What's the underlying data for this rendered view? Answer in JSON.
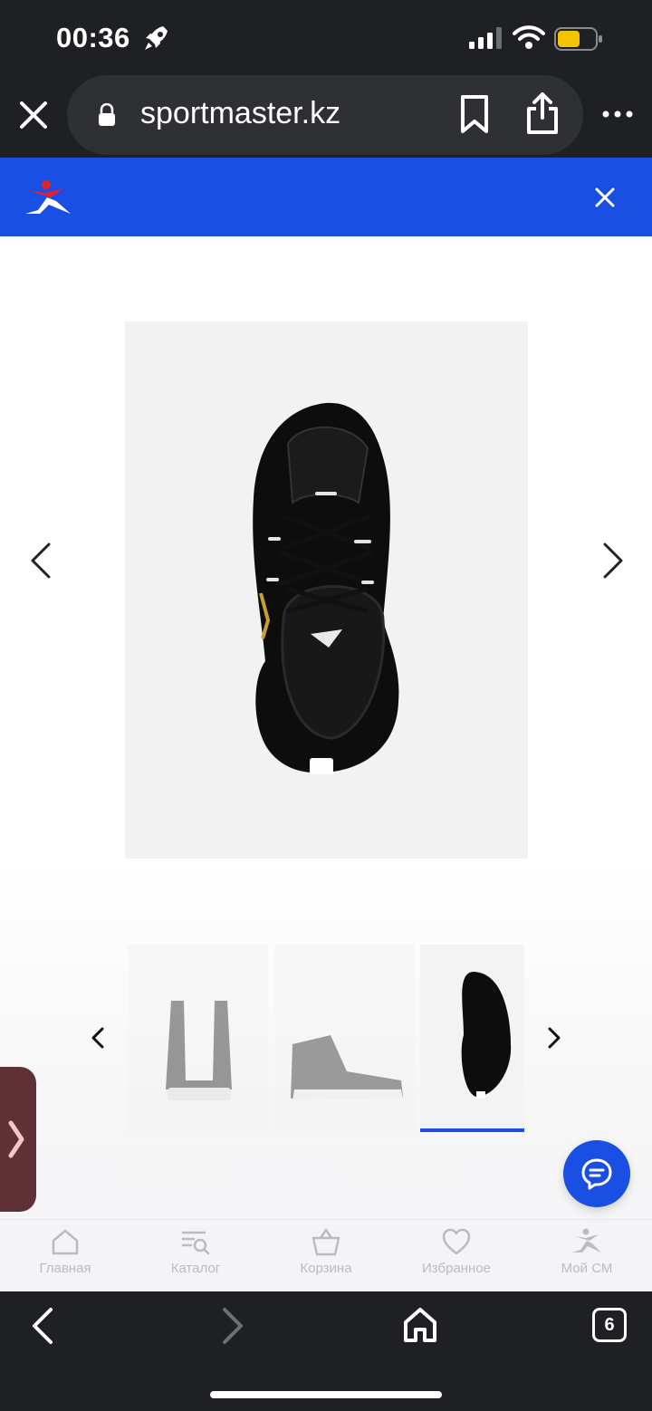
{
  "status_bar": {
    "time": "00:36",
    "icons": [
      "rocket-icon",
      "signal-icon",
      "wifi-icon",
      "battery-icon"
    ],
    "battery_color": "#f5c400"
  },
  "browser": {
    "url": "sportmaster.kz",
    "tab_count": "6",
    "icons": [
      "close-icon",
      "lock-icon",
      "bookmark-icon",
      "share-icon",
      "more-icon",
      "back-icon",
      "forward-icon",
      "home-icon"
    ]
  },
  "banner": {
    "brand_color": "#1a4fe3",
    "logo": "sportmaster-logo",
    "close_icon": "close-icon"
  },
  "product_gallery": {
    "selected_index": 3,
    "thumbnails": [
      {
        "view": "back"
      },
      {
        "view": "side"
      },
      {
        "view": "top"
      }
    ],
    "main_image_view": "top"
  },
  "bottom_nav": {
    "items": [
      {
        "label": "Главная",
        "icon": "home-icon"
      },
      {
        "label": "Каталог",
        "icon": "catalog-search-icon"
      },
      {
        "label": "Корзина",
        "icon": "basket-icon"
      },
      {
        "label": "Избранное",
        "icon": "heart-icon"
      },
      {
        "label": "Мой СМ",
        "icon": "sportmaster-logo-icon"
      }
    ]
  },
  "colors": {
    "accent": "#1a4fe3",
    "chrome_dark": "#1f2023",
    "nav_text": "#b9bcc4"
  }
}
